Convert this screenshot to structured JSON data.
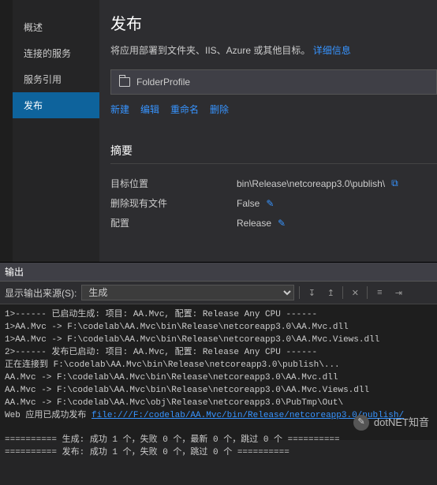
{
  "sidebar": {
    "items": [
      {
        "label": "概述"
      },
      {
        "label": "连接的服务"
      },
      {
        "label": "服务引用"
      },
      {
        "label": "发布"
      }
    ]
  },
  "main": {
    "title": "发布",
    "subtitle_text": "将应用部署到文件夹、IIS、Azure 或其他目标。",
    "subtitle_link": "详细信息",
    "profile_name": "FolderProfile",
    "actions": {
      "new": "新建",
      "edit": "编辑",
      "rename": "重命名",
      "delete": "删除"
    },
    "summary_header": "摘要",
    "summary": [
      {
        "label": "目标位置",
        "value": "bin\\Release\\netcoreapp3.0\\publish\\",
        "icon": "copy"
      },
      {
        "label": "删除现有文件",
        "value": "False",
        "icon": "edit"
      },
      {
        "label": "配置",
        "value": "Release",
        "icon": "edit"
      }
    ]
  },
  "output": {
    "panel_title": "输出",
    "source_label": "显示输出来源(S):",
    "source_value": "生成",
    "lines": [
      "1>------ 已启动生成: 项目: AA.Mvc, 配置: Release Any CPU ------",
      "1>AA.Mvc -> F:\\codelab\\AA.Mvc\\bin\\Release\\netcoreapp3.0\\AA.Mvc.dll",
      "1>AA.Mvc -> F:\\codelab\\AA.Mvc\\bin\\Release\\netcoreapp3.0\\AA.Mvc.Views.dll",
      "2>------ 发布已启动: 项目: AA.Mvc, 配置: Release Any CPU ------",
      "正在连接到 F:\\codelab\\AA.Mvc\\bin\\Release\\netcoreapp3.0\\publish\\...",
      "AA.Mvc -> F:\\codelab\\AA.Mvc\\bin\\Release\\netcoreapp3.0\\AA.Mvc.dll",
      "AA.Mvc -> F:\\codelab\\AA.Mvc\\bin\\Release\\netcoreapp3.0\\AA.Mvc.Views.dll",
      "AA.Mvc -> F:\\codelab\\AA.Mvc\\obj\\Release\\netcoreapp3.0\\PubTmp\\Out\\"
    ],
    "publish_prefix": "Web 应用已成功发布 ",
    "publish_link": "file:///F:/codelab/AA.Mvc/bin/Release/netcoreapp3.0/publish/",
    "footer1": "========== 生成: 成功 1 个，失败 0 个，最新 0 个，跳过 0 个 ==========",
    "footer2": "========== 发布: 成功 1 个，失败 0 个，跳过 0 个 =========="
  },
  "watermark": "dotNET知音"
}
